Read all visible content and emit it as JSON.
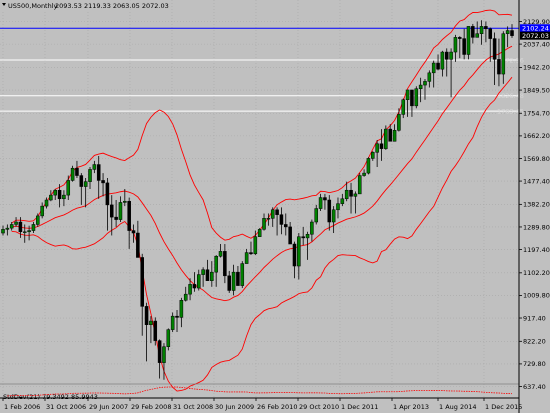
{
  "colors": {
    "background": "#c0c0c0",
    "grid": "#a8a8a8",
    "candle_up": "#008000",
    "candle_down": "#000000",
    "wick": "#000000",
    "bollinger": "#ff0000",
    "blue_level": "#0000ff",
    "white_level": "#ffffff",
    "label_bg": "#000000",
    "label_fg": "#ffffff",
    "level_label_text": "#d8d8d8"
  },
  "header": {
    "symbol": "US500,Monthly",
    "ohlc": "2093.53 2119.33 2063.05 2072.03"
  },
  "indicator": {
    "text": "StdDev(21) 79.3492 85.9943"
  },
  "axis_x_labels": [
    "1 Feb 2006",
    "31 Oct 2006",
    "29 Jun 2007",
    "29 Feb 2008",
    "31 Oct 2008",
    "30 Jun 2009",
    "26 Feb 2010",
    "29 Oct 2010",
    "1 Dec 2011",
    "1 Apr 2013",
    "1 Aug 2014",
    "1 Dec 2015"
  ],
  "axis_y_labels": [
    "2129.90",
    "2037.40",
    "1942.20",
    "1849.50",
    "1754.70",
    "1662.20",
    "1569.80",
    "1477.40",
    "1382.20",
    "1289.80",
    "1197.40",
    "1102.20",
    "1009.80",
    "917.40",
    "822.20",
    "729.80",
    "637.40"
  ],
  "price_tags": {
    "blue_level": "2102.24",
    "current": "2072.03"
  },
  "levels": {
    "white": [
      "1972.56",
      "1826.48",
      "1763.45"
    ]
  },
  "chart_data": {
    "type": "candlestick",
    "title": "",
    "symbol": "US500",
    "timeframe": "Monthly",
    "ylim": [
      630,
      2200
    ],
    "start": "Jan 2006",
    "end": "Nov 2015",
    "open": [
      1265,
      1280,
      1285,
      1300,
      1310,
      1270,
      1270,
      1275,
      1300,
      1335,
      1375,
      1400,
      1420,
      1440,
      1405,
      1420,
      1480,
      1530,
      1500,
      1455,
      1475,
      1525,
      1545,
      1480,
      1470,
      1380,
      1330,
      1320,
      1390,
      1395,
      1275,
      1265,
      1165,
      965,
      890,
      905,
      825,
      735,
      800,
      870,
      925,
      920,
      990,
      1015,
      1055,
      1040,
      1095,
      1115,
      1070,
      1105,
      1170,
      1190,
      1090,
      1030,
      1105,
      1050,
      1140,
      1185,
      1180,
      1250,
      1280,
      1325,
      1325,
      1360,
      1340,
      1300,
      1290,
      1220,
      1130,
      1250,
      1245,
      1260,
      1310,
      1365,
      1410,
      1400,
      1310,
      1360,
      1385,
      1405,
      1440,
      1415,
      1425,
      1500,
      1510,
      1570,
      1595,
      1630,
      1610,
      1690,
      1640,
      1685,
      1750,
      1810,
      1850,
      1785,
      1855,
      1870,
      1885,
      1920,
      1960,
      1935,
      2005,
      1975,
      2005,
      2065,
      2060,
      1995,
      2110,
      2065,
      2080,
      2110,
      2100,
      2060,
      1975,
      1915,
      2080,
      2093
    ],
    "high": [
      1295,
      1300,
      1310,
      1330,
      1330,
      1300,
      1295,
      1310,
      1345,
      1390,
      1410,
      1440,
      1445,
      1465,
      1440,
      1500,
      1540,
      1560,
      1510,
      1490,
      1535,
      1560,
      1580,
      1510,
      1490,
      1420,
      1400,
      1415,
      1445,
      1410,
      1300,
      1315,
      1180,
      980,
      925,
      920,
      830,
      815,
      875,
      940,
      950,
      1000,
      1045,
      1080,
      1105,
      1115,
      1125,
      1155,
      1150,
      1175,
      1220,
      1220,
      1110,
      1135,
      1130,
      1150,
      1200,
      1230,
      1275,
      1285,
      1345,
      1345,
      1370,
      1370,
      1370,
      1345,
      1310,
      1230,
      1265,
      1290,
      1270,
      1320,
      1380,
      1425,
      1425,
      1420,
      1375,
      1410,
      1425,
      1475,
      1470,
      1435,
      1510,
      1525,
      1575,
      1600,
      1645,
      1690,
      1705,
      1710,
      1710,
      1775,
      1815,
      1850,
      1850,
      1865,
      1900,
      1895,
      1930,
      1970,
      1995,
      2010,
      2020,
      2020,
      2075,
      2070,
      2100,
      2110,
      2120,
      2130,
      2135,
      2130,
      2105,
      2085,
      2060,
      2090,
      2110,
      2119
    ],
    "low": [
      1255,
      1255,
      1275,
      1290,
      1245,
      1225,
      1235,
      1265,
      1290,
      1325,
      1365,
      1395,
      1400,
      1370,
      1375,
      1400,
      1475,
      1490,
      1380,
      1370,
      1445,
      1510,
      1405,
      1415,
      1275,
      1255,
      1290,
      1310,
      1375,
      1200,
      1225,
      1165,
      845,
      740,
      815,
      805,
      670,
      665,
      785,
      860,
      860,
      880,
      985,
      990,
      1025,
      1030,
      1045,
      1070,
      1045,
      1045,
      1165,
      1060,
      1020,
      1010,
      1050,
      1040,
      1140,
      1175,
      1175,
      1250,
      1275,
      1295,
      1290,
      1255,
      1260,
      1255,
      1230,
      1080,
      1075,
      1215,
      1155,
      1230,
      1300,
      1355,
      1360,
      1275,
      1265,
      1325,
      1375,
      1395,
      1345,
      1345,
      1425,
      1495,
      1505,
      1560,
      1535,
      1560,
      1605,
      1640,
      1640,
      1680,
      1735,
      1740,
      1740,
      1775,
      1800,
      1810,
      1860,
      1860,
      1930,
      1905,
      1905,
      1820,
      1965,
      1980,
      1975,
      1975,
      2040,
      2065,
      2035,
      2045,
      1965,
      1870,
      1865,
      1875,
      2025,
      2063
    ],
    "close": [
      1280,
      1285,
      1300,
      1310,
      1270,
      1270,
      1275,
      1300,
      1335,
      1375,
      1400,
      1420,
      1440,
      1405,
      1420,
      1480,
      1530,
      1500,
      1455,
      1475,
      1525,
      1545,
      1480,
      1470,
      1380,
      1330,
      1320,
      1390,
      1395,
      1275,
      1265,
      1165,
      965,
      890,
      905,
      825,
      735,
      800,
      870,
      925,
      920,
      990,
      1015,
      1055,
      1040,
      1095,
      1115,
      1070,
      1105,
      1170,
      1190,
      1090,
      1030,
      1105,
      1050,
      1140,
      1185,
      1180,
      1250,
      1280,
      1325,
      1325,
      1360,
      1340,
      1300,
      1290,
      1220,
      1130,
      1250,
      1245,
      1260,
      1310,
      1365,
      1410,
      1400,
      1310,
      1360,
      1385,
      1405,
      1440,
      1415,
      1425,
      1500,
      1510,
      1570,
      1595,
      1630,
      1610,
      1690,
      1640,
      1685,
      1750,
      1810,
      1850,
      1785,
      1855,
      1870,
      1885,
      1920,
      1960,
      1935,
      2005,
      1975,
      2005,
      2065,
      2060,
      1995,
      2110,
      2065,
      2080,
      2110,
      2100,
      2060,
      1975,
      1915,
      2080,
      2093,
      2072
    ],
    "indicators": [
      "Bollinger Bands",
      "StdDev(21)"
    ]
  }
}
